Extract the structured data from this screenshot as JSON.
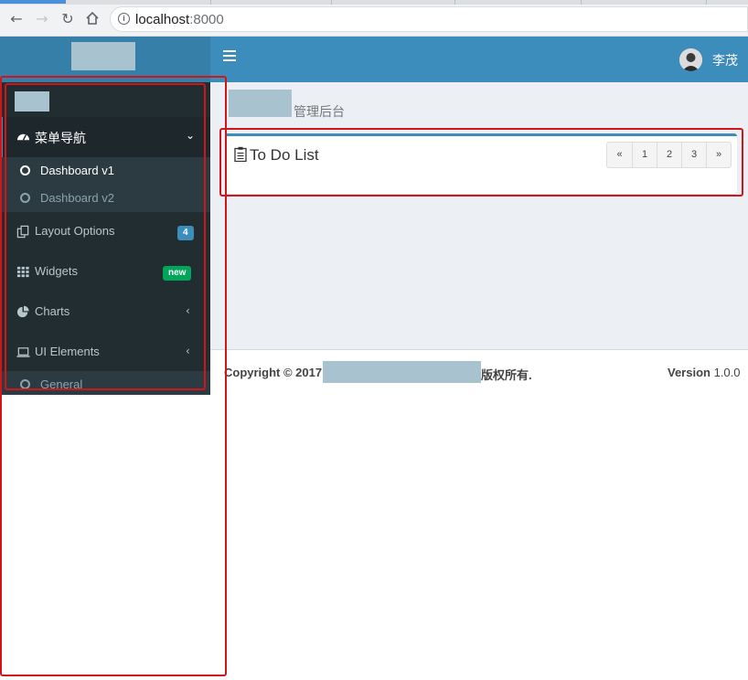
{
  "browser": {
    "url_host": "localhost",
    "url_port": ":8000"
  },
  "header": {
    "user_name": "李茂"
  },
  "sidebar": {
    "menu_header": "菜单导航",
    "submenu": [
      {
        "label": "Dashboard v1",
        "active": true
      },
      {
        "label": "Dashboard v2",
        "active": false
      }
    ],
    "items": [
      {
        "label": "Layout Options",
        "badge": "4",
        "badge_color": "#3c8dbc",
        "icon": "copy-icon"
      },
      {
        "label": "Widgets",
        "badge": "new",
        "badge_color": "#00a65a",
        "icon": "grid-icon"
      },
      {
        "label": "Charts",
        "icon": "pie-chart-icon"
      },
      {
        "label": "UI Elements",
        "icon": "laptop-icon"
      }
    ],
    "partial_item": "General"
  },
  "content": {
    "title_suffix": "管理后台",
    "todo": {
      "title": "To Do List",
      "pager": [
        "«",
        "1",
        "2",
        "3",
        "»"
      ]
    }
  },
  "footer": {
    "copyright_prefix": "Copyright © 2017",
    "copyright_suffix": "版权所有.",
    "version_label": "Version",
    "version_number": "1.0.0"
  },
  "colors": {
    "topbar": "#3c8dbc",
    "logo_bar": "#367fa9",
    "sidebar": "#222d32",
    "annotation": "#d0151b"
  }
}
